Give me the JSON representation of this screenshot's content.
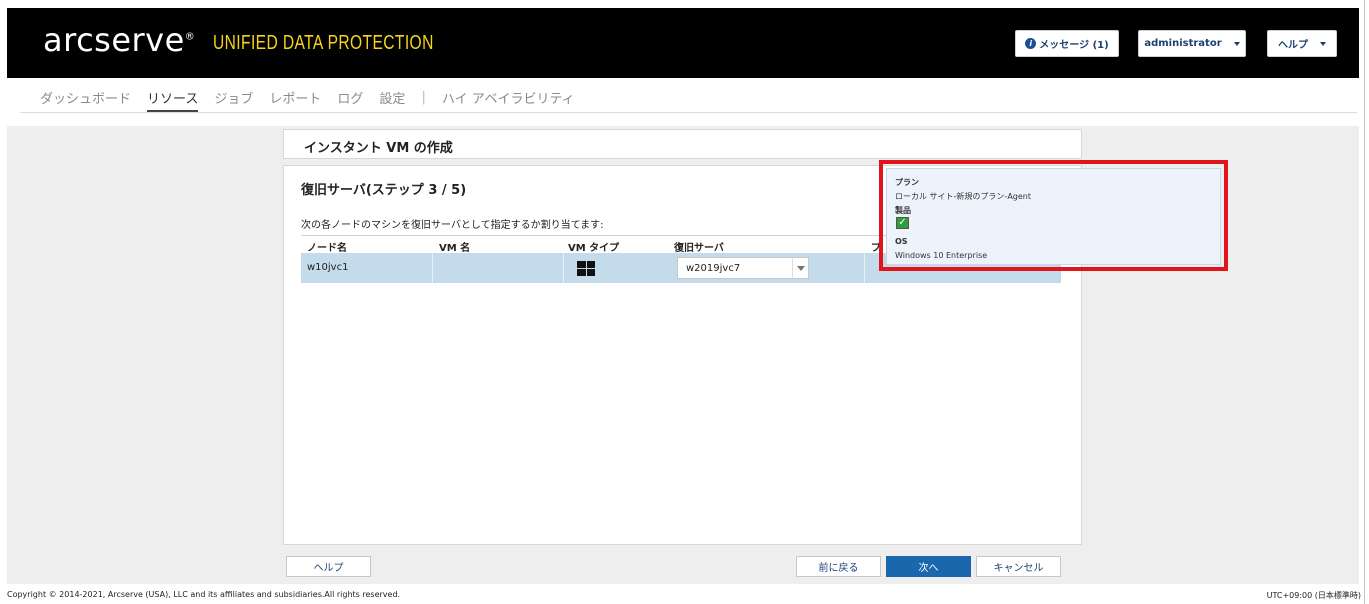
{
  "header": {
    "logo_text": "arcserve",
    "logo_mark": "®",
    "product_name": "UNIFIED DATA PROTECTION",
    "messages_label": "メッセージ (1)",
    "user_label": "administrator",
    "help_label": "ヘルプ"
  },
  "nav": {
    "items": [
      "ダッシュボード",
      "リソース",
      "ジョブ",
      "レポート",
      "ログ",
      "設定",
      "ハイ アベイラビリティ"
    ],
    "active": "リソース",
    "separator": "|"
  },
  "wizard": {
    "title": "インスタント VM の作成",
    "step_title": "復旧サーバ(ステップ 3 / 5)",
    "description": "次の各ノードのマシンを復旧サーバとして指定するか割り当てます:",
    "columns": [
      "ノード名",
      "VM 名",
      "VM タイプ",
      "復旧サーバ",
      "プ"
    ],
    "rows": [
      {
        "node_name": "w10jvc1",
        "vm_name": "",
        "vm_type_icon": "windows-icon",
        "recovery_server": "w2019jvc7"
      }
    ]
  },
  "tooltip": {
    "plan_label": "プラン",
    "plan_value": "ローカル サイト-新規のプラン-Agent",
    "product_label": "製品",
    "product_icon": "agent-check-icon",
    "os_label": "OS",
    "os_value": "Windows 10 Enterprise",
    "highlight_color": "#e1131b"
  },
  "buttons": {
    "help": "ヘルプ",
    "back": "前に戻る",
    "next": "次へ",
    "cancel": "キャンセル"
  },
  "footer": {
    "copyright": "Copyright © 2014-2021, Arcserve (USA), LLC and its affiliates and subsidiaries.All rights reserved.",
    "timezone": "UTC+09:00 (日本標準時)"
  },
  "colors": {
    "header_bg": "#000000",
    "brand_yellow": "#f7d417",
    "primary_button": "#1a67ad",
    "row_selected": "#c3dbea"
  }
}
